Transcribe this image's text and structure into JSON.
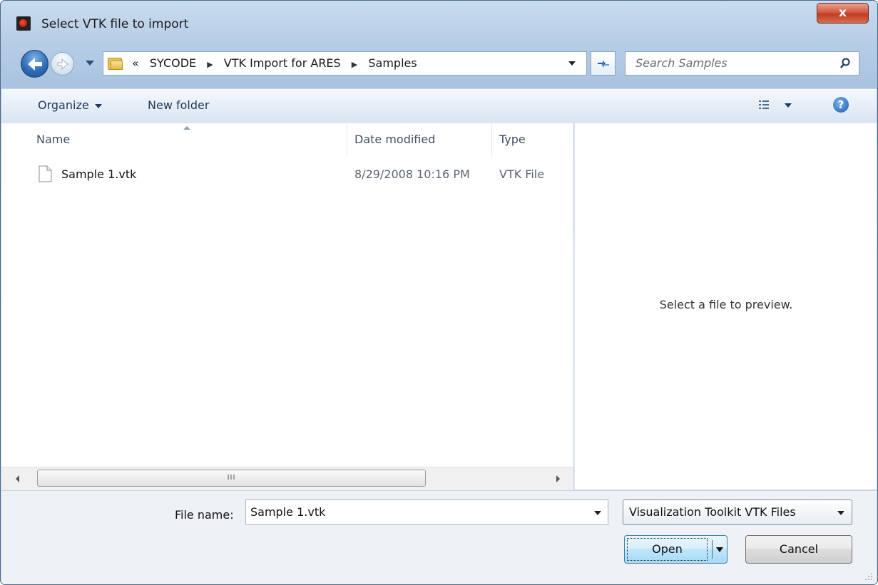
{
  "window": {
    "title": "Select VTK file to import",
    "close_label": "x"
  },
  "navigation": {
    "chevron": "«",
    "breadcrumbs": [
      "SYCODE",
      "VTK Import for ARES",
      "Samples"
    ],
    "search_placeholder": "Search Samples"
  },
  "toolbar": {
    "organize_label": "Organize",
    "new_folder_label": "New folder",
    "help_label": "?"
  },
  "file_list": {
    "columns": [
      "Name",
      "Date modified",
      "Type"
    ],
    "rows": [
      {
        "name": "Sample 1.vtk",
        "date_modified": "8/29/2008 10:16 PM",
        "type": "VTK File"
      }
    ],
    "scroll_thumb_label": "III"
  },
  "preview": {
    "message": "Select a file to preview."
  },
  "footer": {
    "file_name_label": "File name:",
    "file_name_value": "Sample 1.vtk",
    "file_type_filter": "Visualization Toolkit VTK Files",
    "open_label": "Open",
    "cancel_label": "Cancel"
  },
  "icons": {
    "app": "vtk-app-icon",
    "back": "back-arrow-icon",
    "forward": "forward-arrow-icon",
    "folder": "folder-icon",
    "refresh": "refresh-icon",
    "search": "search-icon",
    "views": "view-options-icon",
    "help": "help-icon",
    "file": "document-icon"
  },
  "colors": {
    "frame": "#b6cde6",
    "close_button": "#c13b22",
    "toolbar_text": "#1e395b",
    "open_button": "#bee6fd"
  }
}
